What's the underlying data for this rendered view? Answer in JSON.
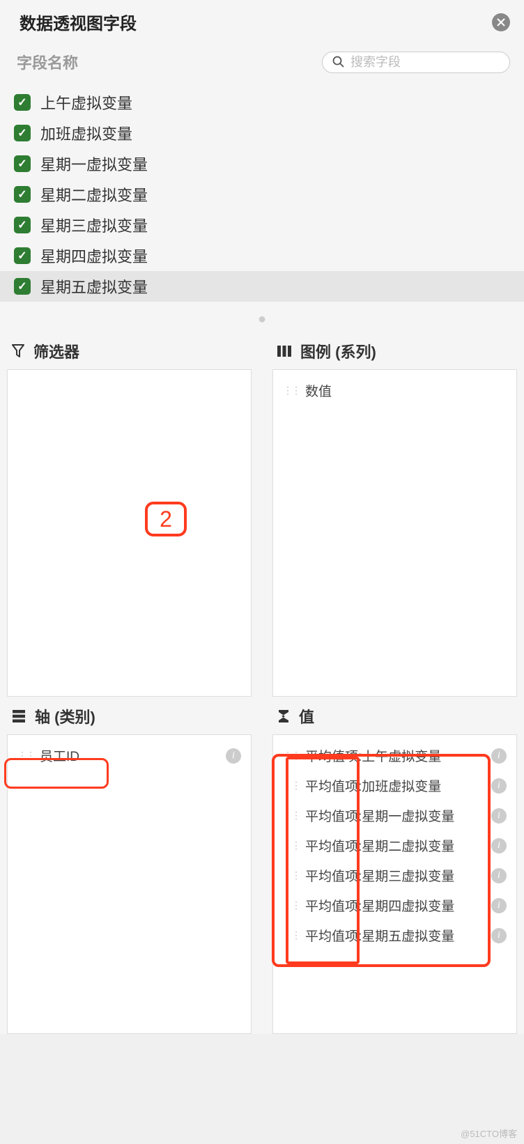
{
  "header": {
    "title": "数据透视图字段",
    "close_icon": "close"
  },
  "search": {
    "field_name_label": "字段名称",
    "placeholder": "搜索字段"
  },
  "fields": [
    {
      "label": "上午虚拟变量",
      "checked": true,
      "highlighted": false
    },
    {
      "label": "加班虚拟变量",
      "checked": true,
      "highlighted": false
    },
    {
      "label": "星期一虚拟变量",
      "checked": true,
      "highlighted": false
    },
    {
      "label": "星期二虚拟变量",
      "checked": true,
      "highlighted": false
    },
    {
      "label": "星期三虚拟变量",
      "checked": true,
      "highlighted": false
    },
    {
      "label": "星期四虚拟变量",
      "checked": true,
      "highlighted": false
    },
    {
      "label": "星期五虚拟变量",
      "checked": true,
      "highlighted": true
    }
  ],
  "sections": {
    "filter": {
      "title": "筛选器",
      "items": []
    },
    "legend": {
      "title": "图例 (系列)",
      "items": [
        {
          "label": "数值"
        }
      ]
    },
    "axis": {
      "title": "轴 (类别)",
      "items": [
        {
          "label": "员工ID"
        }
      ]
    },
    "values": {
      "title": "值",
      "items": [
        {
          "label": "平均值项:上午虚拟变量"
        },
        {
          "label": "平均值项:加班虚拟变量"
        },
        {
          "label": "平均值项:星期一虚拟变量"
        },
        {
          "label": "平均值项:星期二虚拟变量"
        },
        {
          "label": "平均值项:星期三虚拟变量"
        },
        {
          "label": "平均值项:星期四虚拟变量"
        },
        {
          "label": "平均值项:星期五虚拟变量"
        }
      ]
    }
  },
  "annotations": {
    "step": "2"
  },
  "watermark": "@51CTO博客"
}
